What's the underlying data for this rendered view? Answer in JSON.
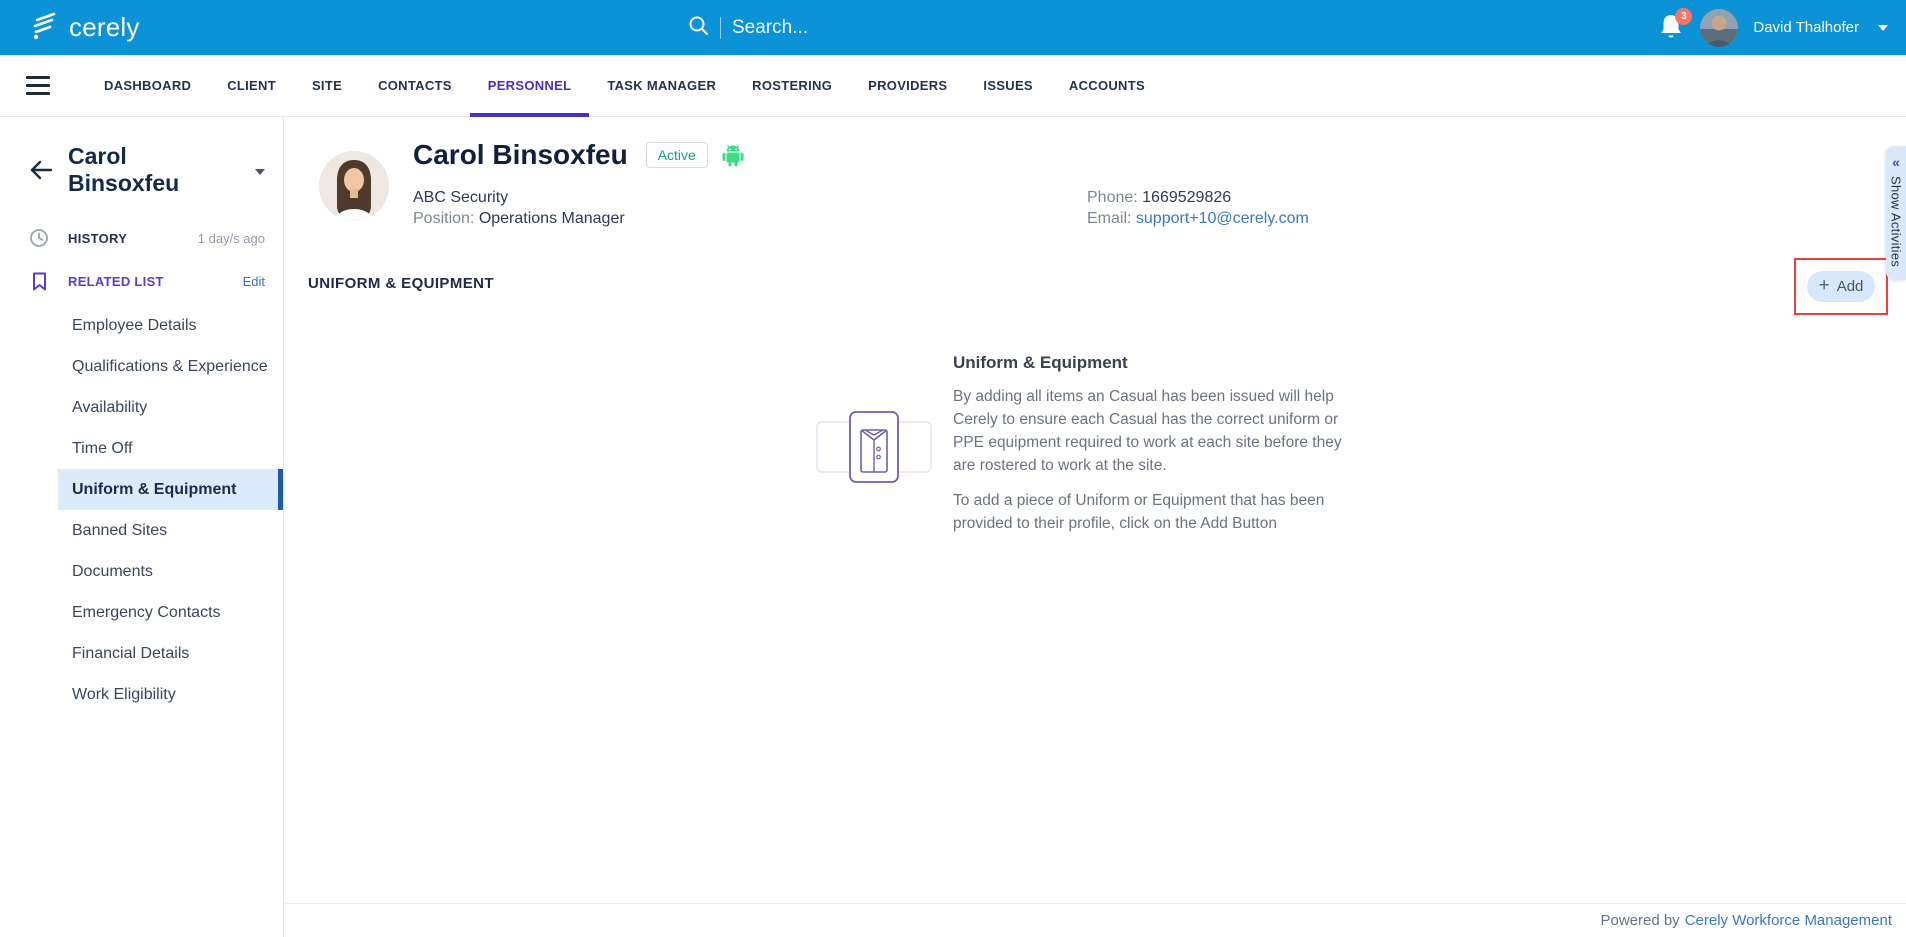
{
  "header": {
    "brand": "cerely",
    "search": {
      "placeholder": "Search..."
    },
    "notifications": {
      "count": "3"
    },
    "user": {
      "name": "David Thalhofer"
    }
  },
  "nav": {
    "tabs": [
      {
        "label": "DASHBOARD",
        "active": false
      },
      {
        "label": "CLIENT",
        "active": false
      },
      {
        "label": "SITE",
        "active": false
      },
      {
        "label": "CONTACTS",
        "active": false
      },
      {
        "label": "PERSONNEL",
        "active": true
      },
      {
        "label": "TASK MANAGER",
        "active": false
      },
      {
        "label": "ROSTERING",
        "active": false
      },
      {
        "label": "PROVIDERS",
        "active": false
      },
      {
        "label": "ISSUES",
        "active": false
      },
      {
        "label": "ACCOUNTS",
        "active": false
      }
    ]
  },
  "sidebar": {
    "person_name": "Carol Binsoxfeu",
    "history": {
      "label": "HISTORY",
      "timestamp": "1 day/s ago"
    },
    "related_list": {
      "label": "RELATED LIST",
      "edit_label": "Edit"
    },
    "items": [
      {
        "label": "Employee Details",
        "selected": false
      },
      {
        "label": "Qualifications & Experience",
        "selected": false
      },
      {
        "label": "Availability",
        "selected": false
      },
      {
        "label": "Time Off",
        "selected": false
      },
      {
        "label": "Uniform & Equipment",
        "selected": true
      },
      {
        "label": "Banned Sites",
        "selected": false
      },
      {
        "label": "Documents",
        "selected": false
      },
      {
        "label": "Emergency Contacts",
        "selected": false
      },
      {
        "label": "Financial Details",
        "selected": false
      },
      {
        "label": "Work Eligibility",
        "selected": false
      }
    ]
  },
  "profile": {
    "name": "Carol Binsoxfeu",
    "status": "Active",
    "company": "ABC Security",
    "position_label": "Position: ",
    "position": "Operations Manager",
    "phone_label": "Phone: ",
    "phone": "1669529826",
    "email_label": "Email: ",
    "email": "support+10@cerely.com"
  },
  "section": {
    "title": "UNIFORM & EQUIPMENT",
    "add_label": "Add",
    "add_plus": "+"
  },
  "empty_state": {
    "title": "Uniform & Equipment",
    "paragraph1": "By adding all items an Casual has been issued will help Cerely to ensure each Casual has the correct uniform or PPE equipment required to work at each site before they are rostered to work at the site.",
    "paragraph2": "To add a piece of Uniform or Equipment that has been provided to their profile, click on the Add Button"
  },
  "activities_tab": {
    "label": "Show Activities",
    "collapse_glyph": "«"
  },
  "footer": {
    "powered_by": "Powered by",
    "link_label": "Cerely Workforce Management"
  },
  "colors": {
    "header_blue": "#0c93d7",
    "active_tab_purple": "#4531c9",
    "related_purple": "#5b3dc8",
    "selected_item_bg": "#dcebf9",
    "selected_item_bar": "#1e5ba9",
    "add_button_bg": "#d8e8fb",
    "annotation_red": "#e8433b",
    "badge_salmon": "#f4756b",
    "status_teal": "#16a085",
    "android_green": "#3ddc84",
    "link_blue": "#3b76c4"
  }
}
